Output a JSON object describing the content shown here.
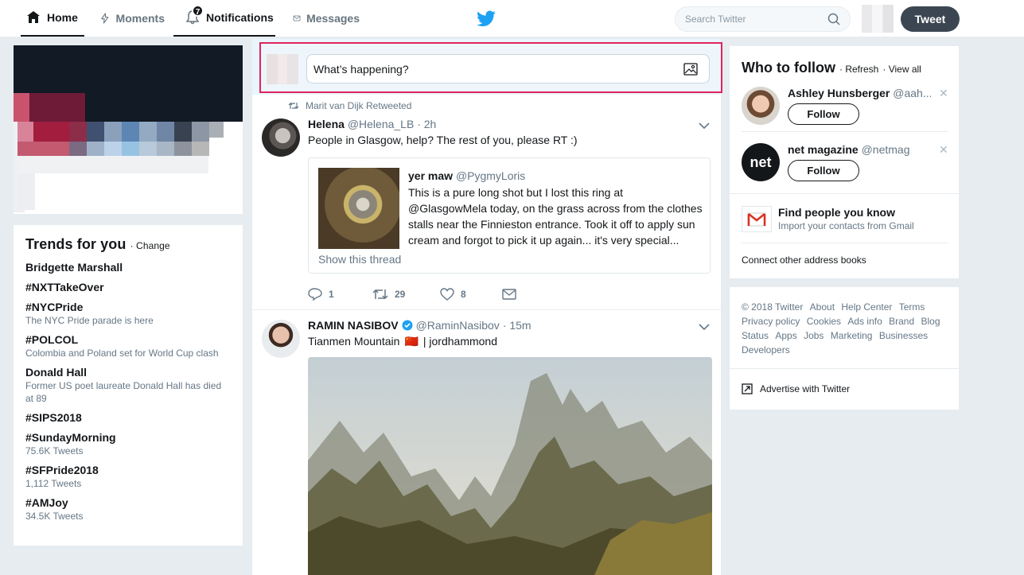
{
  "nav": {
    "home": "Home",
    "moments": "Moments",
    "notifications": "Notifications",
    "notifications_badge": "7",
    "messages": "Messages",
    "search_placeholder": "Search Twitter",
    "tweet_button": "Tweet",
    "brand_color": "#1da1f2"
  },
  "compose": {
    "placeholder": "What’s happening?"
  },
  "trends": {
    "title": "Trends for you",
    "change": "· Change",
    "items": [
      {
        "name": "Bridgette Marshall",
        "desc": ""
      },
      {
        "name": "#NXTTakeOver",
        "desc": ""
      },
      {
        "name": "#NYCPride",
        "desc": "The NYC Pride parade is here"
      },
      {
        "name": "#POLCOL",
        "desc": "Colombia and Poland set for World Cup clash"
      },
      {
        "name": "Donald Hall",
        "desc": "Former US poet laureate Donald Hall has died at 89"
      },
      {
        "name": "#SIPS2018",
        "desc": ""
      },
      {
        "name": "#SundayMorning",
        "desc": "75.6K Tweets"
      },
      {
        "name": "#SFPride2018",
        "desc": "1,112 Tweets"
      },
      {
        "name": "#AMJoy",
        "desc": "34.5K Tweets"
      }
    ]
  },
  "tweets": [
    {
      "context": "Marit van Dijk Retweeted",
      "name": "Helena",
      "handle": "@Helena_LB",
      "time": "· 2h",
      "text": "People in Glasgow, help? The rest of you, please RT :)",
      "quote": {
        "name": "yer maw",
        "handle": "@PygmyLoris",
        "text": "This is a pure long shot but I lost this ring at @GlasgowMela today, on the grass across from the clothes stalls near the Finnieston entrance. Took it off to apply sun cream and forgot to pick it up again... it's very special...",
        "show_thread": "Show this thread"
      },
      "replies": "1",
      "retweets": "29",
      "likes": "8"
    },
    {
      "name": "RAMIN NASIBOV",
      "handle": "@RaminNasibov",
      "time": "· 15m",
      "text_before_flag": "Tianmen Mountain",
      "flag": "🇨🇳",
      "text_after_flag": "| jordhammond"
    }
  ],
  "who_to_follow": {
    "title": "Who to follow",
    "refresh": "· Refresh",
    "view_all": "· View all",
    "accounts": [
      {
        "name": "Ashley Hunsberger",
        "handle": "@aah...",
        "button": "Follow"
      },
      {
        "name": "net magazine",
        "handle": "@netmag",
        "button": "Follow",
        "logo": "net"
      }
    ],
    "find_title": "Find people you know",
    "find_sub": "Import your contacts from Gmail",
    "connect": "Connect other address books"
  },
  "footer": {
    "links": [
      "© 2018 Twitter",
      "About",
      "Help Center",
      "Terms",
      "Privacy policy",
      "Cookies",
      "Ads info",
      "Brand",
      "Blog",
      "Status",
      "Apps",
      "Jobs",
      "Marketing",
      "Businesses",
      "Developers"
    ],
    "advertise": "Advertise with Twitter"
  }
}
